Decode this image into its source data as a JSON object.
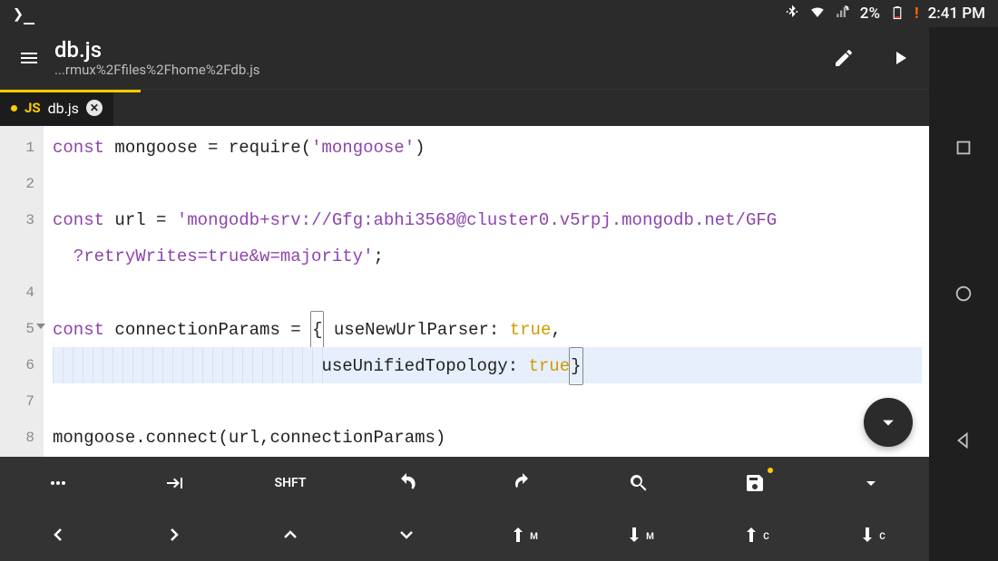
{
  "statusbar": {
    "prompt_glyph": "❯_",
    "battery_percent": "2%",
    "battery_warn": "!",
    "clock": "2:41 PM"
  },
  "appbar": {
    "title": "db.js",
    "subtitle": "...rmux%2Ffiles%2Fhome%2Fdb.js"
  },
  "tab": {
    "lang": "JS",
    "filename": "db.js"
  },
  "code": {
    "lines": [
      {
        "n": "1",
        "html": "<span class='kw'>const</span> <span class='id'>mongoose</span> <span class='pn'>=</span> <span class='id'>require</span><span class='pn'>(</span><span class='str'>'mongoose'</span><span class='pn'>)</span>"
      },
      {
        "n": "2",
        "html": ""
      },
      {
        "n": "3",
        "html": "<span class='kw'>const</span> <span class='id'>url</span> <span class='pn'>=</span> <span class='str'>'mongodb+srv://Gfg:abhi3568@cluster0.v5rpj.mongodb.net/GFG</span>"
      },
      {
        "n": "",
        "html": "  <span class='str'>?retryWrites=true&amp;w=majority'</span><span class='pn'>;</span>"
      },
      {
        "n": "4",
        "html": ""
      },
      {
        "n": "5",
        "fold": true,
        "html": "<span class='kw'>const</span> <span class='id'>connectionParams</span> <span class='pn'>=</span> <span class='pn bracket-hl'>{</span> <span class='id'>useNewUrlParser</span><span class='pn'>:</span> <span class='bool'>true</span><span class='pn'>,</span>"
      },
      {
        "n": "6",
        "active": true,
        "indent": true,
        "html": "                          <span class='id'>useUnifiedTopology</span><span class='pn'>:</span> <span class='bool'>true</span><span class='pn bracket-hl'>}</span>"
      },
      {
        "n": "7",
        "html": ""
      },
      {
        "n": "8",
        "html": "<span class='id'>mongoose</span><span class='pn'>.</span><span class='id'>connect</span><span class='pn'>(</span><span class='id'>url</span><span class='pn'>,</span><span class='id'>connectionParams</span><span class='pn'>)</span>"
      }
    ]
  },
  "toolbar_row1": [
    {
      "name": "more",
      "glyph": "dots"
    },
    {
      "name": "tab-key",
      "glyph": "tab"
    },
    {
      "name": "shift",
      "label": "SHFT"
    },
    {
      "name": "undo",
      "glyph": "undo"
    },
    {
      "name": "redo",
      "glyph": "redo"
    },
    {
      "name": "search",
      "glyph": "search"
    },
    {
      "name": "save",
      "glyph": "save",
      "dirty": true
    },
    {
      "name": "dropdown",
      "glyph": "caret"
    }
  ],
  "toolbar_row2": [
    {
      "name": "prev",
      "glyph": "chev-l"
    },
    {
      "name": "next",
      "glyph": "chev-r"
    },
    {
      "name": "up",
      "glyph": "chev-u"
    },
    {
      "name": "down",
      "glyph": "chev-d"
    },
    {
      "name": "move-up",
      "glyph": "arrow-u",
      "sub": "M"
    },
    {
      "name": "move-down",
      "glyph": "arrow-d",
      "sub": "M"
    },
    {
      "name": "copy-up",
      "glyph": "arrow-u",
      "sub": "C"
    },
    {
      "name": "copy-down",
      "glyph": "arrow-d",
      "sub": "C"
    }
  ]
}
